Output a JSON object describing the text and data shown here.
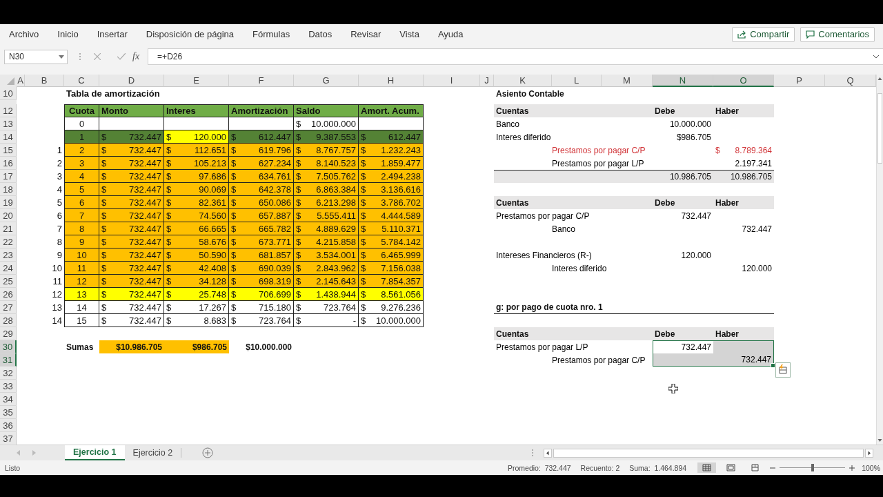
{
  "menu": {
    "items": [
      "Archivo",
      "Inicio",
      "Insertar",
      "Disposición de página",
      "Fórmulas",
      "Datos",
      "Revisar",
      "Vista",
      "Ayuda"
    ],
    "share_button": "Compartir",
    "comments_button": "Comentarios"
  },
  "formula_bar": {
    "name_box": "N30",
    "fx": "fx",
    "formula": "=+D26"
  },
  "sheet": {
    "columns": [
      {
        "label": "A",
        "selected": false
      },
      {
        "label": "B",
        "selected": false
      },
      {
        "label": "C",
        "selected": false
      },
      {
        "label": "D",
        "selected": false
      },
      {
        "label": "E",
        "selected": false
      },
      {
        "label": "F",
        "selected": false
      },
      {
        "label": "G",
        "selected": false
      },
      {
        "label": "H",
        "selected": false
      },
      {
        "label": "I",
        "selected": false
      },
      {
        "label": "J",
        "selected": false
      },
      {
        "label": "K",
        "selected": false
      },
      {
        "label": "L",
        "selected": false
      },
      {
        "label": "M",
        "selected": false
      },
      {
        "label": "N",
        "selected": true
      },
      {
        "label": "O",
        "selected": true
      },
      {
        "label": "P",
        "selected": false
      },
      {
        "label": "Q",
        "selected": false
      }
    ],
    "row_numbers": [
      {
        "label": "10",
        "selected": false
      },
      {
        "label": "12",
        "selected": false
      },
      {
        "label": "13",
        "selected": false
      },
      {
        "label": "14",
        "selected": false
      },
      {
        "label": "15",
        "selected": false
      },
      {
        "label": "16",
        "selected": false
      },
      {
        "label": "17",
        "selected": false
      },
      {
        "label": "18",
        "selected": false
      },
      {
        "label": "19",
        "selected": false
      },
      {
        "label": "20",
        "selected": false
      },
      {
        "label": "21",
        "selected": false
      },
      {
        "label": "22",
        "selected": false
      },
      {
        "label": "23",
        "selected": false
      },
      {
        "label": "24",
        "selected": false
      },
      {
        "label": "25",
        "selected": false
      },
      {
        "label": "26",
        "selected": false
      },
      {
        "label": "27",
        "selected": false
      },
      {
        "label": "28",
        "selected": false
      },
      {
        "label": "29",
        "selected": false
      },
      {
        "label": "30",
        "selected": true
      },
      {
        "label": "31",
        "selected": true
      },
      {
        "label": "32",
        "selected": false
      },
      {
        "label": "33",
        "selected": false
      },
      {
        "label": "34",
        "selected": false
      },
      {
        "label": "35",
        "selected": false
      },
      {
        "label": "36",
        "selected": false
      },
      {
        "label": "37",
        "selected": false
      }
    ],
    "amortization": {
      "title": "Tabla de amortización",
      "headers": [
        "Cuota",
        "Monto",
        "Interes",
        "Amortización",
        "Saldo",
        "Amort. Acum."
      ],
      "rows": [
        {
          "values": {
            "cuota": "0",
            "saldo": "$ 10.000.000"
          },
          "color": "#ffffff"
        },
        {
          "values": {
            "cuota": "1",
            "monto": "$ 732.447",
            "interes": "$ 120.000",
            "amortizacion": "$ 612.447",
            "saldo": "$ 9.387.553",
            "amort_acum": "$ 612.447"
          },
          "color": "#548235",
          "interes_cell": {
            "color": "#ffff00"
          }
        },
        {
          "number": "1",
          "values": {
            "cuota": "2",
            "monto": "$ 732.447",
            "interes": "$ 112.651",
            "amortizacion": "$ 619.796",
            "saldo": "$ 8.767.757",
            "amort_acum": "$ 1.232.243"
          },
          "color": "#ffc000"
        },
        {
          "number": "2",
          "values": {
            "cuota": "3",
            "monto": "$ 732.447",
            "interes": "$ 105.213",
            "amortizacion": "$ 627.234",
            "saldo": "$ 8.140.523",
            "amort_acum": "$ 1.859.477"
          },
          "color": "#ffc000"
        },
        {
          "number": "3",
          "values": {
            "cuota": "4",
            "monto": "$ 732.447",
            "interes": "$ 97.686",
            "amortizacion": "$ 634.761",
            "saldo": "$ 7.505.762",
            "amort_acum": "$ 2.494.238"
          },
          "color": "#ffc000"
        },
        {
          "number": "4",
          "values": {
            "cuota": "5",
            "monto": "$ 732.447",
            "interes": "$ 90.069",
            "amortizacion": "$ 642.378",
            "saldo": "$ 6.863.384",
            "amort_acum": "$ 3.136.616"
          },
          "color": "#ffc000"
        },
        {
          "number": "5",
          "values": {
            "cuota": "6",
            "monto": "$ 732.447",
            "interes": "$ 82.361",
            "amortizacion": "$ 650.086",
            "saldo": "$ 6.213.298",
            "amort_acum": "$ 3.786.702"
          },
          "color": "#ffc000"
        },
        {
          "number": "6",
          "values": {
            "cuota": "7",
            "monto": "$ 732.447",
            "interes": "$ 74.560",
            "amortizacion": "$ 657.887",
            "saldo": "$ 5.555.411",
            "amort_acum": "$ 4.444.589"
          },
          "color": "#ffc000"
        },
        {
          "number": "7",
          "values": {
            "cuota": "8",
            "monto": "$ 732.447",
            "interes": "$ 66.665",
            "amortizacion": "$ 665.782",
            "saldo": "$ 4.889.629",
            "amort_acum": "$ 5.110.371"
          },
          "color": "#ffc000"
        },
        {
          "number": "8",
          "values": {
            "cuota": "9",
            "monto": "$ 732.447",
            "interes": "$ 58.676",
            "amortizacion": "$ 673.771",
            "saldo": "$ 4.215.858",
            "amort_acum": "$ 5.784.142"
          },
          "color": "#ffc000"
        },
        {
          "number": "9",
          "values": {
            "cuota": "10",
            "monto": "$ 732.447",
            "interes": "$ 50.590",
            "amortizacion": "$ 681.857",
            "saldo": "$ 3.534.001",
            "amort_acum": "$ 6.465.999"
          },
          "color": "#ffc000"
        },
        {
          "number": "10",
          "values": {
            "cuota": "11",
            "monto": "$ 732.447",
            "interes": "$ 42.408",
            "amortizacion": "$ 690.039",
            "saldo": "$ 2.843.962",
            "amort_acum": "$ 7.156.038"
          },
          "color": "#ffc000"
        },
        {
          "number": "11",
          "values": {
            "cuota": "12",
            "monto": "$ 732.447",
            "interes": "$ 34.128",
            "amortizacion": "$ 698.319",
            "saldo": "$ 2.145.643",
            "amort_acum": "$ 7.854.357"
          },
          "color": "#ffc000"
        },
        {
          "number": "12",
          "values": {
            "cuota": "13",
            "monto": "$ 732.447",
            "interes": "$ 25.748",
            "amortizacion": "$ 706.699",
            "saldo": "$ 1.438.944",
            "amort_acum": "$ 8.561.056"
          },
          "color": "#ffff00"
        },
        {
          "number": "13",
          "values": {
            "cuota": "14",
            "monto": "$ 732.447",
            "interes": "$ 17.267",
            "amortizacion": "$ 715.180",
            "saldo": "$ 723.764",
            "amort_acum": "$ 9.276.236"
          },
          "color": "#ffffff"
        },
        {
          "number": "14",
          "values": {
            "cuota": "15",
            "monto": "$ 732.447",
            "interes": "$ 8.683",
            "amortizacion": "$ 723.764",
            "saldo": "$ -",
            "amort_acum": "$ 10.000.000"
          },
          "color": "#ffffff"
        }
      ],
      "sums": {
        "label": "Sumas",
        "values": [
          {
            "text": "$10.986.705",
            "color": "#ffc000"
          },
          {
            "text": "$986.705",
            "color": "#ffc000"
          },
          {
            "text": "$10.000.000",
            "color": "#ffffff"
          }
        ]
      }
    },
    "journal": {
      "title": "Asiento Contable",
      "lines": [
        {
          "kind": "header",
          "account": "Cuentas",
          "debe": "Debe",
          "haber": "Haber",
          "selected": false
        },
        {
          "kind": "account",
          "account": "Banco",
          "debe": "10.000.000",
          "color": "#000000",
          "selected": false
        },
        {
          "kind": "account",
          "account": "Interes diferido",
          "debe": "$986.705",
          "color": "#000000",
          "selected": false
        },
        {
          "kind": "indented",
          "account": "Prestamos por pagar C/P",
          "haber": "$ 8.789.364",
          "color": "#d13438",
          "selected": false
        },
        {
          "kind": "indented",
          "account": "Prestamos por pagar L/P",
          "haber": "2.197.341",
          "color": "#000000",
          "selected": false
        },
        {
          "kind": "total",
          "debe": "10.986.705",
          "haber": "10.986.705",
          "selected": false
        },
        {
          "kind": "blank"
        },
        {
          "kind": "header",
          "account": "Cuentas",
          "debe": "Debe",
          "haber": "Haber",
          "selected": false
        },
        {
          "kind": "account",
          "account": "Prestamos por pagar C/P",
          "debe": "732.447",
          "color": "#000000",
          "selected": false
        },
        {
          "kind": "indented",
          "account": "Banco",
          "haber": "732.447",
          "color": "#000000",
          "selected": false
        },
        {
          "kind": "blank"
        },
        {
          "kind": "account",
          "account": "Intereses Financieros (R-)",
          "debe": "120.000",
          "color": "#000000",
          "selected": false
        },
        {
          "kind": "indented",
          "account": "Interes diferido",
          "haber": "120.000",
          "color": "#000000",
          "selected": false
        },
        {
          "kind": "blank"
        },
        {
          "kind": "blank"
        },
        {
          "kind": "section",
          "account": "g: por pago de cuota nro. 1",
          "selected": false
        },
        {
          "kind": "blank"
        },
        {
          "kind": "header",
          "account": "Cuentas",
          "debe": "Debe",
          "haber": "Haber",
          "selected": false
        },
        {
          "kind": "account",
          "account": "Prestamos por pagar L/P",
          "debe": "732.447",
          "color": "#000000",
          "selected": true
        },
        {
          "kind": "indented",
          "account": "Prestamos por pagar C/P",
          "haber": "732.447",
          "color": "#000000",
          "selected": true
        }
      ]
    }
  },
  "sheet_tabs": [
    {
      "label": "Ejercicio 1",
      "selected": true
    },
    {
      "label": "Ejercicio 2",
      "selected": false
    }
  ],
  "status": {
    "ready": "Listo",
    "average": "Promedio:  732.447",
    "count": "Recuento: 2",
    "sum": "Suma:  1.464.894",
    "views": [
      {
        "kind": "normal",
        "selected": true
      },
      {
        "kind": "page_layout",
        "selected": false
      },
      {
        "kind": "page_break",
        "selected": false
      }
    ],
    "zoom": {
      "level": 0.5,
      "label": "100%"
    }
  }
}
